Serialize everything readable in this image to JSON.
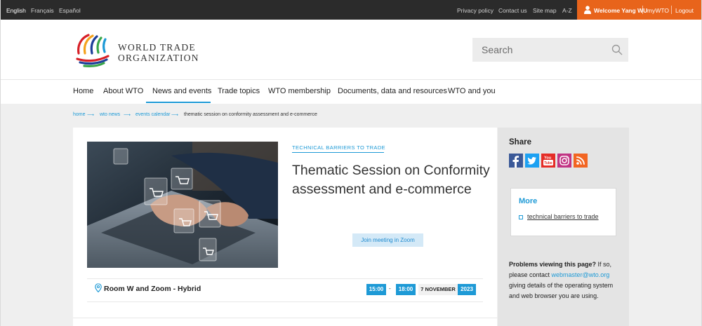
{
  "topbar": {
    "languages": [
      "English",
      "Français",
      "Español"
    ],
    "active_language": "English",
    "utility_links": [
      "Privacy policy",
      "Contact us",
      "Site map",
      "A-Z"
    ],
    "welcome": "Welcome Yang WU",
    "my_link": "myWTO",
    "logout": "Logout",
    "accent_color": "#e8641b"
  },
  "header": {
    "logo_line1": "WORLD TRADE",
    "logo_line2": "ORGANIZATION",
    "search_placeholder": "Search"
  },
  "nav": {
    "items": [
      "Home",
      "About WTO",
      "News and events",
      "Trade topics",
      "WTO membership",
      "Documents, data and resources",
      "WTO and you"
    ],
    "active": "News and events",
    "accent_color": "#1e9ad6"
  },
  "breadcrumb": {
    "items": [
      "home",
      "wto news",
      "events calendar",
      "thematic session on conformity assessment and e-commerce"
    ],
    "separator": "⟶"
  },
  "event": {
    "topic": "TECHNICAL BARRIERS TO TRADE",
    "title": "Thematic Session on Conformity assessment and e-commerce",
    "zoom_button": "Join meeting in Zoom",
    "venue": "Room W and Zoom - Hybrid",
    "start_time": "15:00",
    "time_separator": "-",
    "end_time": "18:00",
    "date": "7 NOVEMBER",
    "year": "2023"
  },
  "sidebar": {
    "share_title": "Share",
    "social_icons": [
      "facebook-icon",
      "twitter-icon",
      "youtube-icon",
      "instagram-icon",
      "rss-icon"
    ],
    "more_title": "More",
    "more_link": "technical barriers to trade",
    "problems_bold": "Problems viewing this page?",
    "problems_text1": " If so, please contact ",
    "problems_email": "webmaster@wto.org",
    "problems_text2": " giving details of the operating system and web browser you are using."
  }
}
